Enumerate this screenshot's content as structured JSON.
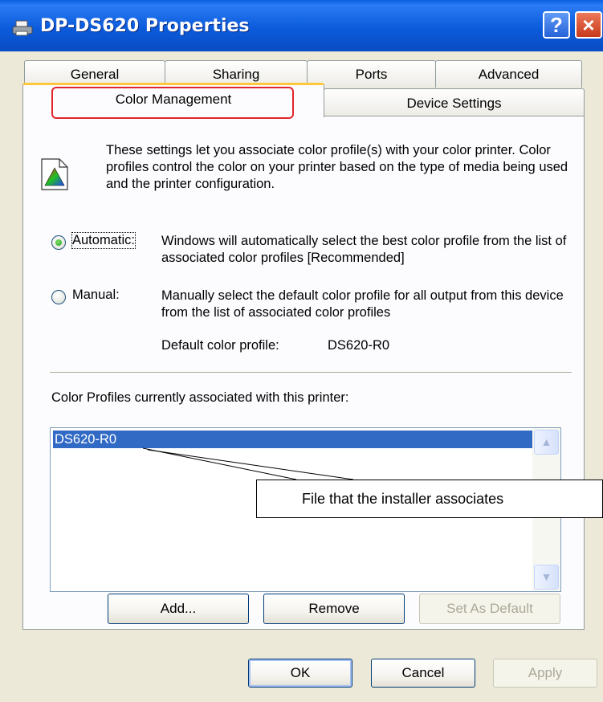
{
  "window": {
    "title": "DP-DS620 Properties"
  },
  "tabs": {
    "general": "General",
    "sharing": "Sharing",
    "ports": "Ports",
    "advanced": "Advanced",
    "color_management": "Color Management",
    "device_settings": "Device Settings"
  },
  "intro": {
    "text": "These settings let you associate color profile(s) with your color printer. Color profiles control the color on your printer based on the type of media being used and the printer configuration."
  },
  "mode": {
    "automatic": {
      "label": "Automatic:",
      "description": "Windows will automatically select the best color profile from the list of associated color profiles [Recommended]",
      "selected": true
    },
    "manual": {
      "label": "Manual:",
      "description": "Manually select the default color profile for all output from this device from the list of associated color profiles",
      "selected": false
    }
  },
  "default_profile": {
    "label": "Default color profile:",
    "value": "DS620-R0"
  },
  "profiles": {
    "label": "Color Profiles currently associated with this printer:",
    "items": [
      "DS620-R0"
    ]
  },
  "buttons": {
    "add": "Add...",
    "remove": "Remove",
    "set_default": "Set As Default",
    "ok": "OK",
    "cancel": "Cancel",
    "apply": "Apply"
  },
  "callout": {
    "text": "File that the installer associates"
  },
  "colors": {
    "titlebar": "#0a5fe0",
    "selection": "#316ac5",
    "highlight_box": "#e0252b",
    "tab_accent": "#ffc83c"
  }
}
